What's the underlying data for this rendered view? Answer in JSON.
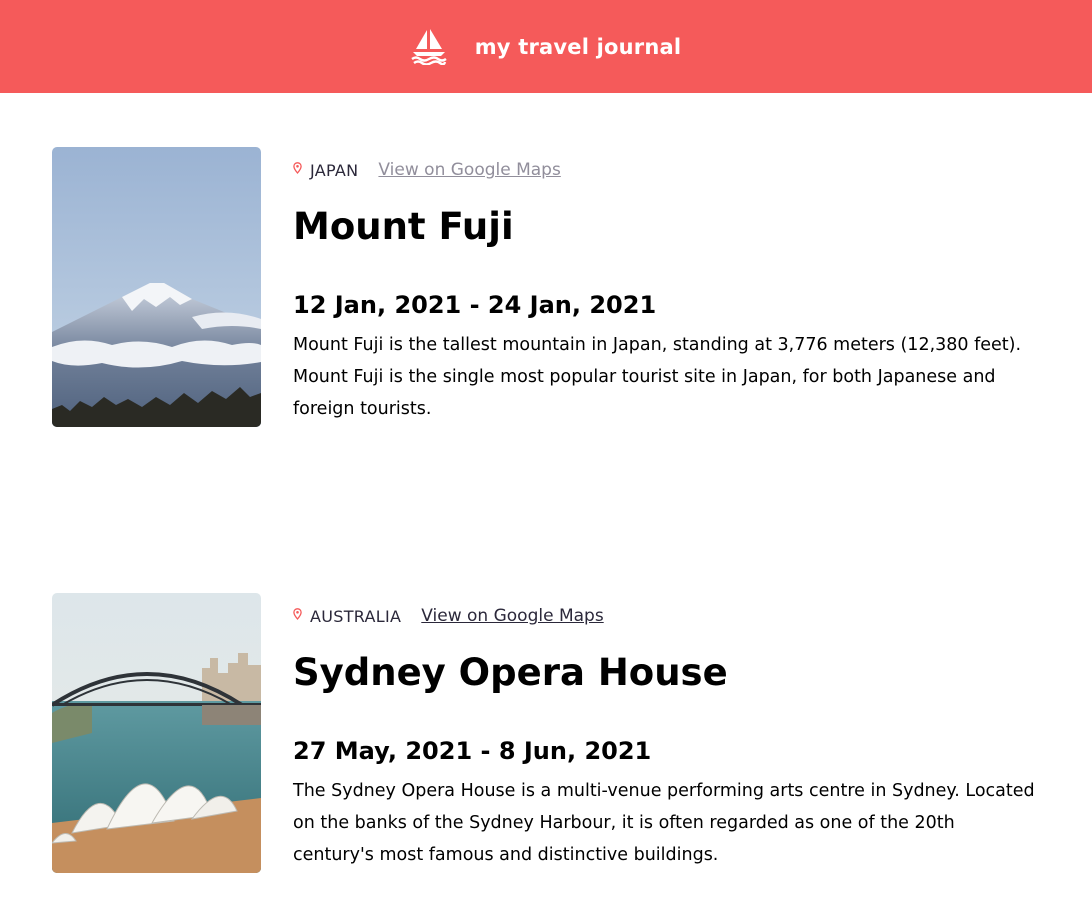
{
  "header": {
    "title": "my travel journal",
    "icon": "sailboat-icon",
    "background_color": "#f55a5a"
  },
  "entries": [
    {
      "country": "JAPAN",
      "maps_link": "View on Google Maps",
      "title": "Mount Fuji",
      "dates": "12 Jan, 2021 - 24 Jan, 2021",
      "description": "Mount Fuji is the tallest mountain in Japan, standing at 3,776 meters (12,380 feet). Mount Fuji is the single most popular tourist site in Japan, for both Japanese and foreign tourists.",
      "image": "mount-fuji-photo"
    },
    {
      "country": "AUSTRALIA",
      "maps_link": "View on Google Maps",
      "title": "Sydney Opera House",
      "dates": "27 May, 2021 - 8 Jun, 2021",
      "description": "The Sydney Opera House is a multi-venue performing arts centre in Sydney. Located on the banks of the Sydney Harbour, it is often regarded as one of the 20th century's most famous and distinctive buildings.",
      "image": "sydney-opera-house-photo"
    }
  ],
  "colors": {
    "accent": "#f55a5a",
    "pin": "#f55a5a",
    "link_muted": "#918e9b",
    "link_dark": "#2b283a"
  }
}
